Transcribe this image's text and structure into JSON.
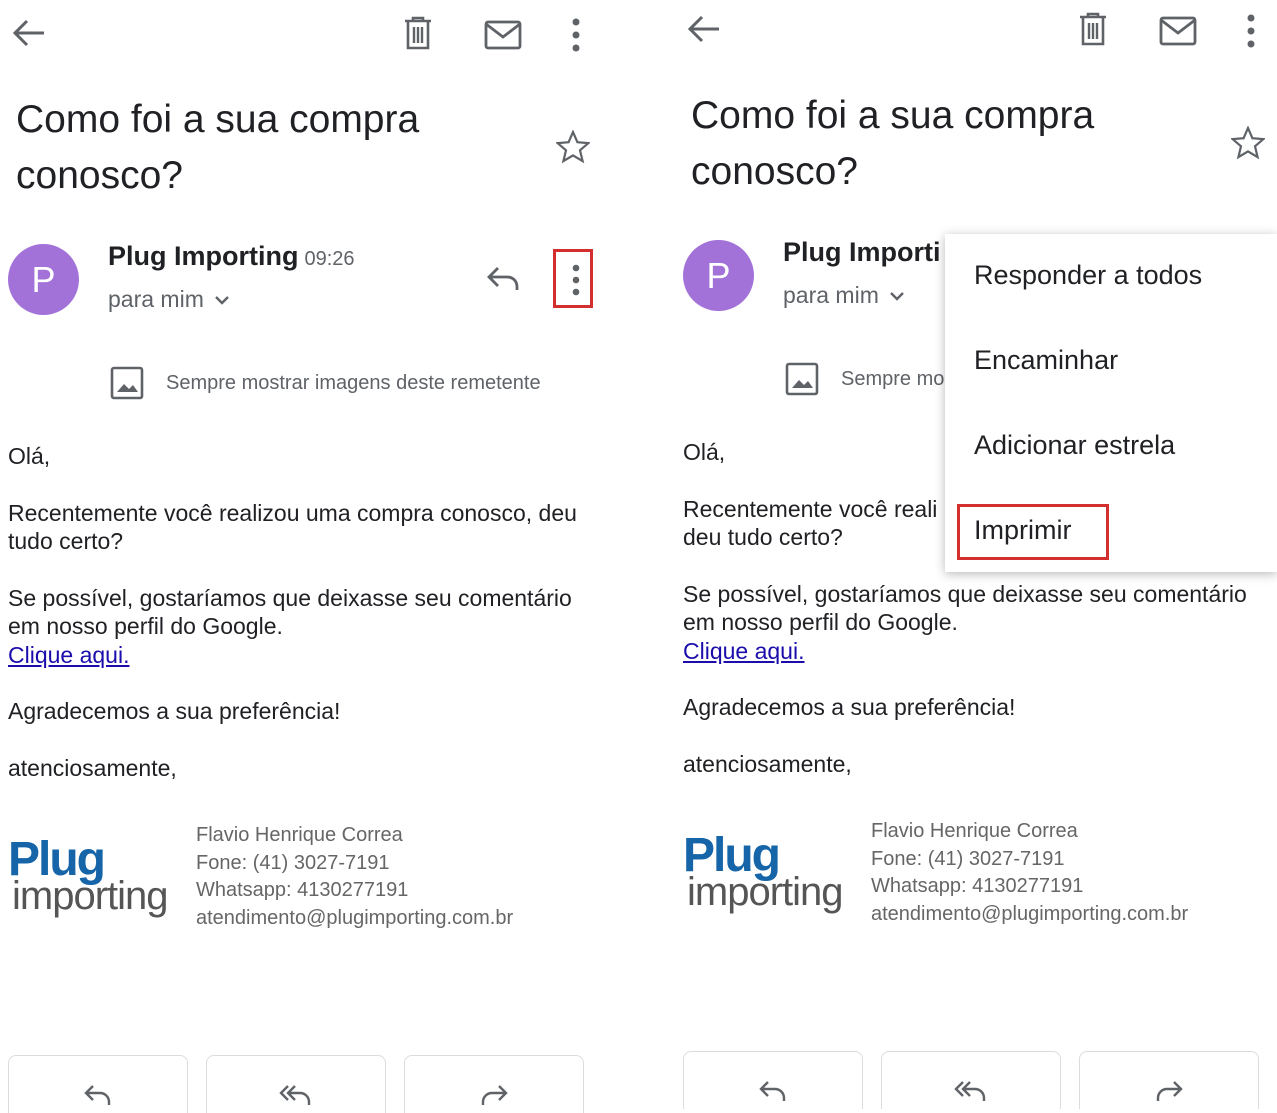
{
  "email": {
    "subject": "Como foi a sua compra conosco?",
    "sender_name": "Plug Importing",
    "time": "09:26",
    "recipient": "para mim",
    "avatar_letter": "P",
    "images_notice": "Sempre mostrar imagens deste remetente",
    "body": {
      "greeting": "Olá,",
      "line1": "Recentemente você realizou uma compra conosco, deu tudo certo?",
      "line2": "Se possível, gostaríamos que deixasse seu comentário em nosso perfil do Google.",
      "link": "Clique aqui.",
      "thanks": "Agradecemos a sua preferência!",
      "closing": "atenciosamente,"
    },
    "logo": {
      "top": "Plug",
      "bottom": "importing"
    },
    "signature": {
      "name": "Flavio Henrique Correa",
      "phone": "Fone: (41) 3027-7191",
      "whatsapp": "Whatsapp: 4130277191",
      "email": "atendimento@plugimporting.com.br"
    }
  },
  "right_panel": {
    "sender_truncated": "Plug Importi",
    "images_notice_truncated": "Sempre mo",
    "body_line1_truncated_a": "Recentemente você reali",
    "body_line1_truncated_b": "deu tudo certo?"
  },
  "overflow_menu": {
    "items": [
      "Responder a todos",
      "Encaminhar",
      "Adicionar estrela",
      "Imprimir"
    ]
  },
  "colors": {
    "avatar": "#a272d9",
    "highlight": "#d32f2f",
    "link": "#1a0dab"
  }
}
